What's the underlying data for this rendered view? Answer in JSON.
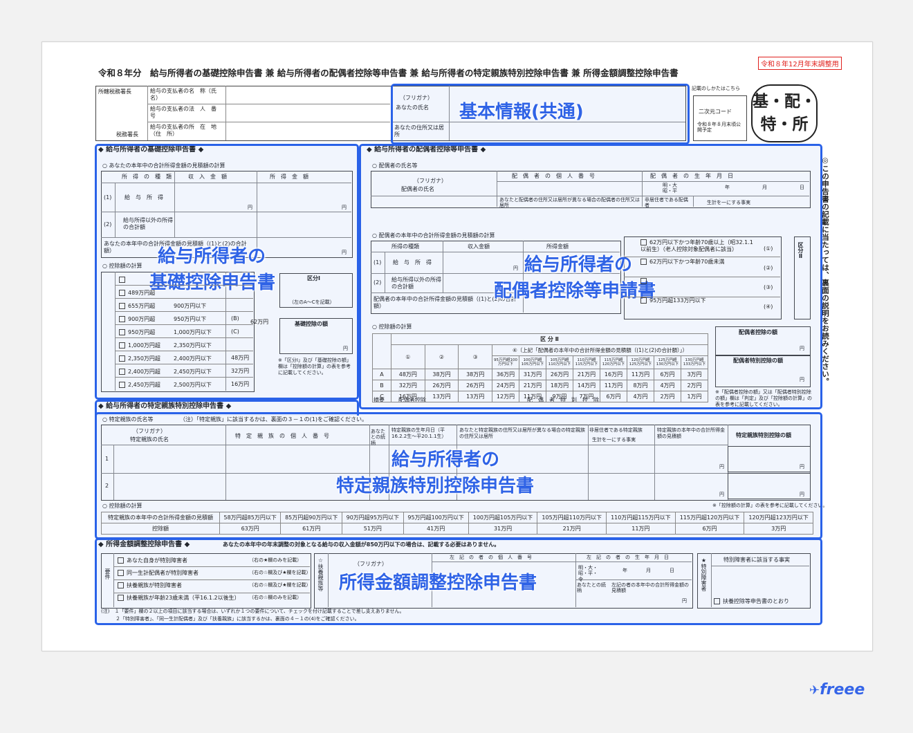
{
  "header": {
    "title": "令和８年分　給与所得者の基礎控除申告書 兼 給与所得者の配偶者控除等申告書 兼 給与所得者の特定親族特別控除申告書 兼 所得金額調整控除申告書",
    "year_tag": "令和８年12月年末調整用"
  },
  "top": {
    "tax_office": "所轄税務署長",
    "tax_office_chief": "税務署長",
    "payer_name": "給与の支払者の名　称（氏　名）",
    "payer_number": "給与の支払者の法　人　番　号",
    "payer_address": "給与の支払者の所　在　地（住　所）",
    "furigana": "（フリガナ）",
    "your_name": "あなたの氏名",
    "your_address": "あなたの住所又は居所",
    "write_howto": "記載のしかたはこちら",
    "qr_label": "二次元コード",
    "qr_note": "令和８年８月末頃公開予定",
    "stamp_line1": "基・配・",
    "stamp_line2": "特・所"
  },
  "sections": {
    "basic": "◆ 給与所得者の基礎控除申告書 ◆",
    "spouse": "◆ 給与所得者の配偶者控除等申告書 ◆",
    "dependent": "◆ 給与所得者の特定親族特別控除申告書 ◆",
    "adjust": "◆ 所得金額調整控除申告書 ◆",
    "adjust_note": "あなたの本年中の年末調整の対象となる給与の収入金額が850万円以下の場合は、記載する必要はありません。"
  },
  "basic": {
    "income_calc": "○ あなたの本年中の合計所得金額の見積額の計算",
    "head_type": "所　得　の　種　類",
    "head_income": "収　入　金　額",
    "head_amount": "所　得　金　額",
    "row1": "給　与　所　得",
    "row2": "給与所得以外の所得の合計額",
    "row_total": "あなたの本年中の合計所得金額の見積額（(1)と(2)の合計額）",
    "deduct_calc": "○ 控除額の計算",
    "kubun": "区分Ⅰ",
    "kubun_note": "（左のA～Cを記載）",
    "deduct_label": "基礎控除の額",
    "yen": "円",
    "rows": [
      {
        "from": "",
        "to": "",
        "val": ""
      },
      {
        "from": "489万円超",
        "to": "",
        "val": ""
      },
      {
        "from": "655万円超",
        "to": "900万円以下",
        "val": ""
      },
      {
        "from": "900万円超",
        "to": "950万円以下",
        "val": "(B)"
      },
      {
        "from": "950万円超",
        "to": "1,000万円以下",
        "val": "(C)"
      },
      {
        "from": "1,000万円超",
        "to": "2,350万円以下",
        "val": ""
      },
      {
        "from": "2,350万円超",
        "to": "2,400万円以下",
        "val": "48万円"
      },
      {
        "from": "2,400万円超",
        "to": "2,450万円以下",
        "val": "32万円"
      },
      {
        "from": "2,450万円超",
        "to": "2,500万円以下",
        "val": "16万円"
      }
    ],
    "bc_amount": "62万円",
    "note": "※「区分Ⅰ」及び「基礎控除の額」欄は「控除額の計算」の表を参考に記載してください。"
  },
  "spouse": {
    "name_section": "○ 配偶者の氏名等",
    "furigana": "（フリガナ）",
    "name": "配偶者の氏名",
    "number": "配　偶　者　の　個　人　番　号",
    "birthday": "配　偶　者　の　生　年　月　日",
    "era": "明・大昭・平",
    "y": "年",
    "mth": "月",
    "d": "日",
    "address": "あなたと配偶者の住所又は居所が異なる場合の配偶者の住所又は居所",
    "non_resident": "非居住者である配偶者",
    "same_living": "生計を一にする事実",
    "income_calc": "○ 配偶者の本年中の合計所得金額の見積額の計算",
    "head_type": "所得の種類",
    "head_income": "収入金額",
    "head_amount": "所得金額",
    "row1": "給　与　所　得",
    "row2": "給与所得以外の所得の合計額",
    "row_total": "配偶者の本年中の合計所得金額の見積額（(1)と(2)の合計額）",
    "yen": "円",
    "opts": [
      {
        "label": "62万円以下かつ年齢70歳以上（昭32.1.1以前生）（老人控除対象配偶者に該当）",
        "mark": "(①)"
      },
      {
        "label": "62万円以下かつ年齢70歳未満",
        "mark": "(②)"
      },
      {
        "label": "",
        "mark": "(③)"
      },
      {
        "label": "95万円超133万円以下",
        "mark": "(④)"
      }
    ],
    "kubun2": "区分Ⅱ",
    "deduct_calc": "○ 控除額の計算",
    "kubun_table_head": "区 分 Ⅱ",
    "col4_head": "④（上記「配偶者の本年中の合計所得金額の見積額（(1)と(2)の合計額）」）",
    "cols": [
      "①",
      "②",
      "③"
    ],
    "ranges": [
      "95万円超100万円以下",
      "100万円超105万円以下",
      "105万円超110万円以下",
      "110万円超115万円以下",
      "115万円超120万円以下",
      "120万円超125万円以下",
      "125万円超130万円以下",
      "130万円超133万円以下"
    ],
    "rowA": [
      "48万円",
      "38万円",
      "38万円",
      "36万円",
      "31万円",
      "26万円",
      "21万円",
      "16万円",
      "11万円",
      "6万円",
      "3万円"
    ],
    "rowB": [
      "32万円",
      "26万円",
      "26万円",
      "24万円",
      "21万円",
      "18万円",
      "14万円",
      "11万円",
      "8万円",
      "4万円",
      "2万円"
    ],
    "rowC": [
      "16万円",
      "13万円",
      "13万円",
      "12万円",
      "11万円",
      "9万円",
      "7万円",
      "6万円",
      "4万円",
      "2万円",
      "1万円"
    ],
    "abc": [
      "A",
      "B",
      "C"
    ],
    "kubun_side": "区分Ⅰ",
    "foot_left": "摘要",
    "foot_a": "配偶者控除",
    "foot_b": "配　偶　者　特　別　控　除",
    "label_deduct": "配偶者控除の額",
    "label_special": "配偶者特別控除の額",
    "note": "※「配偶者控除の額」又は「配偶者特別控除の額」欄は「判定」及び「控除額の計算」の表を参考に記載してください。"
  },
  "dependent": {
    "name_section": "○ 特定親族の氏名等",
    "name_note": "（注）「特定親族」に該当するかは、裏面の３－１の(1)をご確認ください。",
    "furigana": "（フリガナ）",
    "name": "特定親族の氏名",
    "number": "特　定　親　族　の　個　人　番　号",
    "relation": "あなたとの続柄",
    "birthday": "特定親族の生年月日（平16.2.2生～平20.1.1生）",
    "address": "あなたと特定親族の住所又は居所が異なる場合の特定親族の住所又は居所",
    "non_resident": "非居住者である特定親族",
    "same_living": "生計を一にする事実",
    "estimate": "特定親族の本年中の合計所得金額の見積額",
    "deduct": "特定親族特別控除の額",
    "row_nums": [
      "1",
      "2"
    ],
    "yen": "円",
    "deduct_calc": "○ 控除額の計算",
    "table_head": "特定親族の本年中の合計所得金額の見積額",
    "table_row": "控除額",
    "ranges": [
      "58万円超85万円以下",
      "85万円超90万円以下",
      "90万円超95万円以下",
      "95万円超100万円以下",
      "100万円超105万円以下",
      "105万円超110万円以下",
      "110万円超115万円以下",
      "115万円超120万円以下",
      "120万円超123万円以下"
    ],
    "amounts": [
      "63万円",
      "61万円",
      "51万円",
      "41万円",
      "31万円",
      "21万円",
      "11万円",
      "6万円",
      "3万円"
    ],
    "calc_note": "※「控除額の計算」の表を参考に記載してください。"
  },
  "adjust": {
    "req_label": "要件",
    "reqs": [
      {
        "label": "あなた自身が特別障害者",
        "note": "（右の★欄のみを記載）"
      },
      {
        "label": "同一生計配偶者が特別障害者",
        "note": "（右の☆欄及び★欄を記載）"
      },
      {
        "label": "扶養親族が特別障害者",
        "note": "（右の☆欄及び★欄を記載）"
      },
      {
        "label": "扶養親族が年齢23歳未満（平16.1.2以後生）",
        "note": "（右の☆欄のみを記載）"
      }
    ],
    "dep_label": "☆扶養親族等",
    "furigana": "（フリガナ）",
    "number": "左　記　の　者　の　個　人　番　号",
    "birthday": "左　記　の　者　の　生　年　月　日",
    "era": "明・大・昭・平・令",
    "y": "年",
    "mth": "月",
    "d": "日",
    "relation": "あなたとの続柄",
    "estimate": "左記の者の本年中の合計所得金額の見積額",
    "yen": "円",
    "star_label": "★特別障害者",
    "star_head": "特別障害者に該当する事実",
    "star_check": "扶養控除等申告書のとおり",
    "notes": [
      "(注)　１「要件」欄の２以上の項目に該当する場合は、いずれか１つの要件について、チェックを付け記載することで差し支えありません。",
      "　　　２「特別障害者」、「同一生計配偶者」及び「扶養親族」に該当するかは、裏面の４－１の(4)をご確認ください。"
    ]
  },
  "side_note": "◎この申告書の記載に当たっては、裏面の説明をお読みください。",
  "overlays": {
    "common": "基本情報(共通)",
    "basic1": "給与所得者の",
    "basic2": "基礎控除申告書",
    "spouse1": "給与所得者の",
    "spouse2": "配偶者控除等申請書",
    "dep1": "給与所得者の",
    "dep2": "特定親族特別控除申告書",
    "adjust": "所得金額調整控除申告書"
  },
  "logo": "freee",
  "colors": {
    "accent": "#2f63e6",
    "tag": "#e0201c"
  }
}
